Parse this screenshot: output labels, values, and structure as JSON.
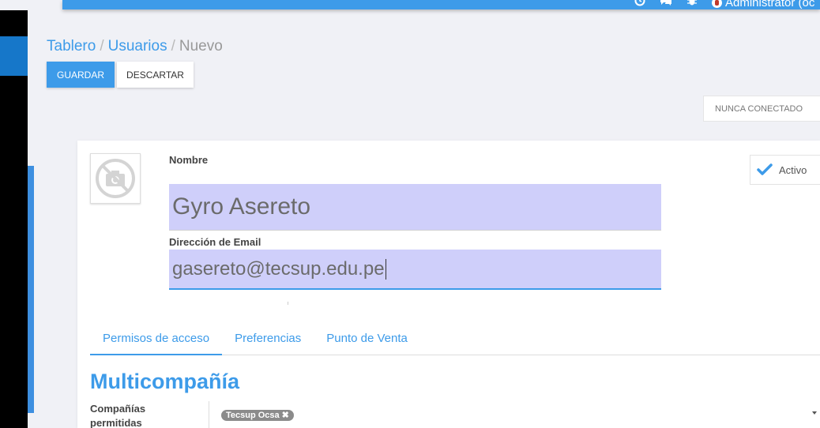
{
  "topbar": {
    "icons": [
      "clock-icon",
      "chat-icon",
      "bug-icon"
    ],
    "user_name": "Administrator (oc"
  },
  "breadcrumb": {
    "items": [
      "Tablero",
      "Usuarios",
      "Nuevo"
    ],
    "separator": "/"
  },
  "toolbar": {
    "save_label": "GUARDAR",
    "discard_label": "DESCARTAR"
  },
  "status": {
    "label": "NUNCA CONECTADO"
  },
  "form": {
    "name_label": "Nombre",
    "name_value": "Gyro Asereto",
    "email_label": "Dirección de Email",
    "email_value": "gasereto@tecsup.edu.pe",
    "active_label": "Activo"
  },
  "tabs": [
    {
      "label": "Permisos de acceso",
      "active": true
    },
    {
      "label": "Preferencias",
      "active": false
    },
    {
      "label": "Punto de Venta",
      "active": false
    }
  ],
  "section": {
    "title": "Multicompañía",
    "field_label": "Compañías permitidas",
    "tags": [
      "Tecsup Ocsa"
    ]
  },
  "colors": {
    "accent": "#3d9be9",
    "input_bg": "#cfcffa",
    "sidebar_blue": "#1677c9"
  }
}
